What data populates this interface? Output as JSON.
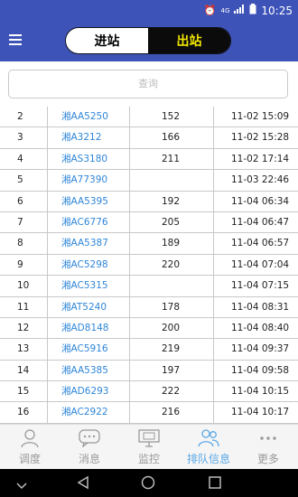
{
  "status_bar": {
    "time": "10:25",
    "network_label": "4G"
  },
  "header": {
    "menu_icon": "hamburger-icon",
    "tab_in_label": "进站",
    "tab_out_label": "出站"
  },
  "search": {
    "placeholder": "查询"
  },
  "table": {
    "rows": [
      {
        "idx": "2",
        "plate": "湘AA5250",
        "val": "152",
        "time": "11-02 15:09"
      },
      {
        "idx": "3",
        "plate": "湘A3212",
        "val": "166",
        "time": "11-02 15:28"
      },
      {
        "idx": "4",
        "plate": "湘AS3180",
        "val": "211",
        "time": "11-02 17:14"
      },
      {
        "idx": "5",
        "plate": "湘A77390",
        "val": "",
        "time": "11-03 22:46"
      },
      {
        "idx": "6",
        "plate": "湘AA5395",
        "val": "192",
        "time": "11-04 06:34"
      },
      {
        "idx": "7",
        "plate": "湘AC6776",
        "val": "205",
        "time": "11-04 06:47"
      },
      {
        "idx": "8",
        "plate": "湘AA5387",
        "val": "189",
        "time": "11-04 06:57"
      },
      {
        "idx": "9",
        "plate": "湘AC5298",
        "val": "220",
        "time": "11-04 07:04"
      },
      {
        "idx": "10",
        "plate": "湘AC5315",
        "val": "",
        "time": "11-04 07:15"
      },
      {
        "idx": "11",
        "plate": "湘AT5240",
        "val": "178",
        "time": "11-04 08:31"
      },
      {
        "idx": "12",
        "plate": "湘AD8148",
        "val": "200",
        "time": "11-04 08:40"
      },
      {
        "idx": "13",
        "plate": "湘AC5916",
        "val": "219",
        "time": "11-04 09:37"
      },
      {
        "idx": "14",
        "plate": "湘AA5385",
        "val": "197",
        "time": "11-04 09:58"
      },
      {
        "idx": "15",
        "plate": "湘AD6293",
        "val": "222",
        "time": "11-04 10:15"
      },
      {
        "idx": "16",
        "plate": "湘AC2922",
        "val": "216",
        "time": "11-04 10:17"
      }
    ]
  },
  "bottom_nav": {
    "items": [
      {
        "label": "调度",
        "icon": "person-icon"
      },
      {
        "label": "消息",
        "icon": "chat-icon"
      },
      {
        "label": "监控",
        "icon": "monitor-icon"
      },
      {
        "label": "排队信息",
        "icon": "users-icon"
      },
      {
        "label": "更多",
        "icon": "more-icon"
      }
    ],
    "active_index": 3
  },
  "colors": {
    "app_bar": "#3d53b8",
    "plate_link": "#2f86d8",
    "active_tab": "#5aa7e6",
    "out_tab_text": "#f2e600"
  }
}
